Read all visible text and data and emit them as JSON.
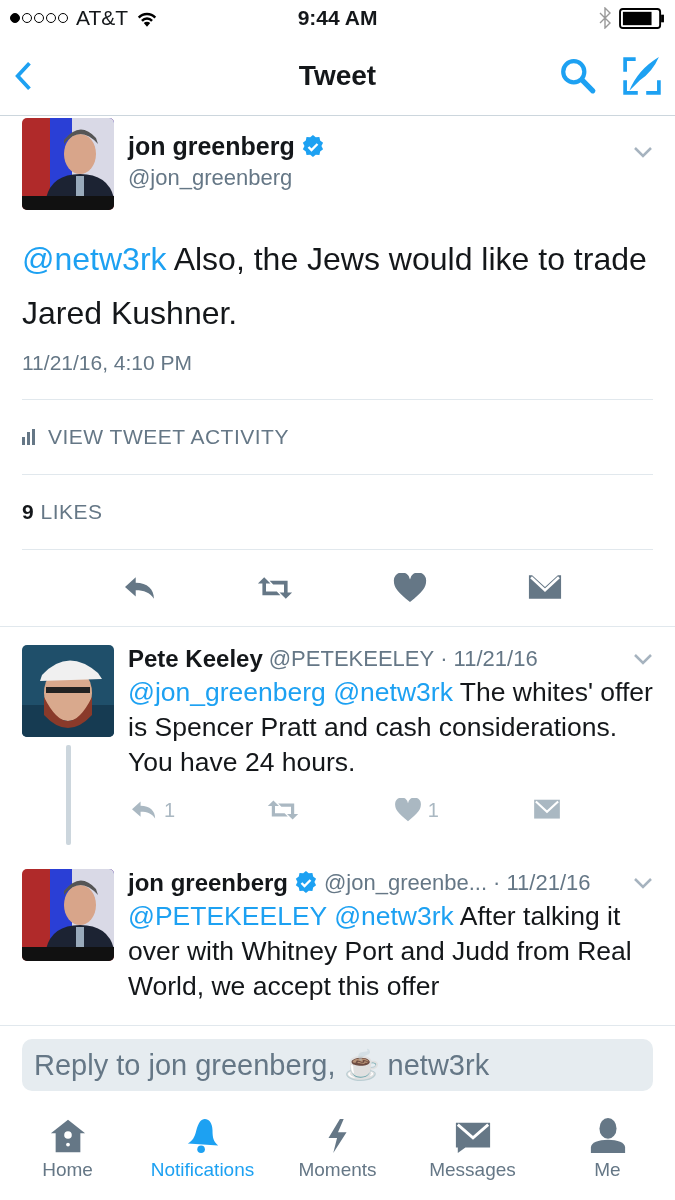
{
  "status_bar": {
    "carrier": "AT&T",
    "time": "9:44 AM"
  },
  "nav": {
    "title": "Tweet"
  },
  "tweet": {
    "name": "jon greenberg",
    "verified": true,
    "handle": "@jon_greenberg",
    "text": [
      {
        "kind": "mention",
        "text": "@netw3rk"
      },
      {
        "kind": "text",
        "text": "Also, the Jews would like to trade Jared Kushner."
      }
    ],
    "date": "11/21/16, 4:10 PM",
    "activity": "VIEW TWEET ACTIVITY",
    "likes_count": "9",
    "likes_label": "LIKES"
  },
  "replies": [
    {
      "name": "Pete Keeley",
      "verified": false,
      "handle": "@PETEKEELEY",
      "date": "· 11/21/16",
      "thread_line": true,
      "text": [
        {
          "kind": "mention",
          "text": "@jon_greenberg"
        },
        {
          "kind": "mention",
          "text": "@netw3rk"
        },
        {
          "kind": "text",
          "text": "The whites' offer is Spencer Pratt and cash considerations. You have 24 hours."
        }
      ],
      "reply_count": "1",
      "like_count": "1"
    },
    {
      "name": "jon greenberg",
      "verified": true,
      "handle": "@jon_greenbe...",
      "date": "· 11/21/16",
      "thread_line": false,
      "text": [
        {
          "kind": "mention",
          "text": "@PETEKEELEY"
        },
        {
          "kind": "mention",
          "text": "@netw3rk"
        },
        {
          "kind": "text",
          "text": "After talking it over with Whitney Port and Judd from Real World, we accept this offer"
        }
      ]
    }
  ],
  "reply_field": {
    "placeholder": "Reply to jon greenberg, ☕ netw3rk"
  },
  "tabs": [
    {
      "label": "Home",
      "selected": false
    },
    {
      "label": "Notifications",
      "selected": true
    },
    {
      "label": "Moments",
      "selected": false
    },
    {
      "label": "Messages",
      "selected": false
    },
    {
      "label": "Me",
      "selected": false
    }
  ]
}
